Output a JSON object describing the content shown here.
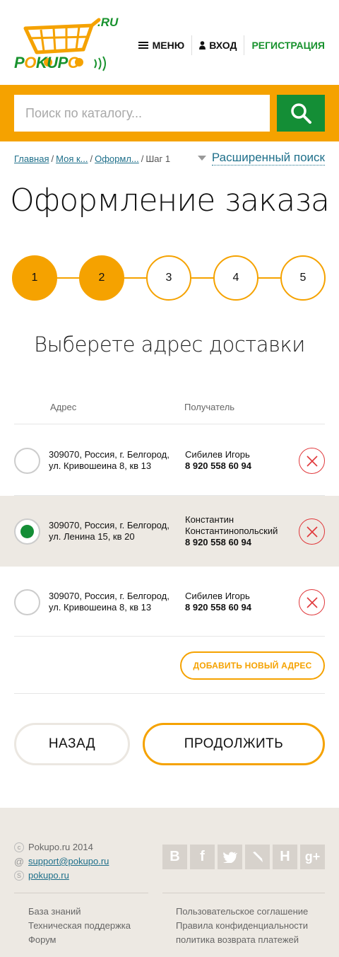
{
  "brand": {
    "name": "POKUPO",
    "domain_suffix": ".RU",
    "accent": "#f5a200",
    "green": "#148e36"
  },
  "nav": {
    "menu": "МЕНЮ",
    "login": "ВХОД",
    "register": "РЕГИСТРАЦИЯ"
  },
  "search": {
    "placeholder": "Поиск по каталогу..."
  },
  "breadcrumb": {
    "items": [
      "Главная",
      "Моя к...",
      "Оформл..."
    ],
    "current": "Шаг 1"
  },
  "advanced_search": "Расширенный поиск",
  "page_title": "Оформление заказа",
  "steps": {
    "items": [
      "1",
      "2",
      "3",
      "4",
      "5"
    ],
    "completed": 2
  },
  "subtitle": "Выберете адрес доставки",
  "table": {
    "headers": {
      "address": "Адрес",
      "recipient": "Получатель"
    },
    "rows": [
      {
        "address": "309070, Россия, г. Белгород, ул. Кривошеина 8, кв 13",
        "name": "Сибилев Игорь",
        "phone": "8 920 558 60 94",
        "selected": false
      },
      {
        "address": "309070, Россия, г. Белгород, ул. Ленина 15, кв 20",
        "name": "Константин Константинопольский",
        "phone": "8 920 558 60 94",
        "selected": true
      },
      {
        "address": "309070, Россия, г. Белгород, ул. Кривошеина 8, кв 13",
        "name": "Сибилев Игорь",
        "phone": "8 920 558 60 94",
        "selected": false
      }
    ]
  },
  "add_address": "ДОБАВИТЬ НОВЫЙ АДРЕС",
  "buttons": {
    "back": "НАЗАД",
    "continue": "ПРОДОЛЖИТЬ"
  },
  "footer": {
    "copyright": "Pokupo.ru 2014",
    "email": "support@pokupo.ru",
    "skype": "pokupo.ru",
    "socials": [
      "vk-icon",
      "facebook-icon",
      "twitter-icon",
      "livejournal-icon",
      "habr-icon",
      "google-plus-icon"
    ],
    "links_left": [
      "База знаний",
      "Техническая поддержка",
      "Форум"
    ],
    "links_right": [
      "Пользовательское соглашение",
      "Правила конфиденциальности",
      "политика возврата платежей"
    ]
  }
}
